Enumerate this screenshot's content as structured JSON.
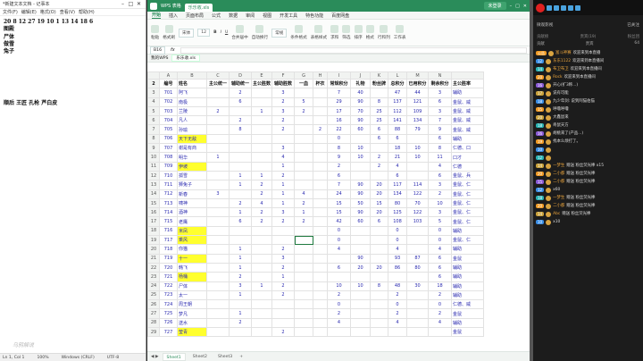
{
  "notepad": {
    "title": "*新建文本文档 - 记事本",
    "menu": [
      "文件(F)",
      "编辑(E)",
      "格式(O)",
      "查看(V)",
      "帮助(H)"
    ],
    "lines": [
      "20 8 12 27 19 10 1 13 14 18 6",
      "图殿",
      "尸体",
      "做雪",
      "兔子",
      "",
      "",
      "",
      "",
      "",
      "",
      "顺后 王匠 孔枪 芦白皮"
    ],
    "status": [
      "Ln 1, Col 1",
      "100%",
      "Windows (CRLF)",
      "UTF-8"
    ],
    "watermark": "乌鸦解说"
  },
  "wps": {
    "title_tab": "WPS 表格",
    "file_tab": "乐乐收.xls",
    "login": "未登录",
    "menu": [
      "开始",
      "插入",
      "页面布局",
      "公式",
      "数据",
      "审阅",
      "视图",
      "开发工具",
      "特色功能",
      "百度网盘"
    ],
    "ribbon": {
      "font": "宋体",
      "size": "12",
      "labels": [
        "粘贴",
        "格式刷",
        "合并居中",
        "自动换行",
        "常规",
        "条件格式",
        "表格样式",
        "求和",
        "筛选",
        "排序",
        "格式",
        "行和列",
        "工作表"
      ]
    },
    "cell_ref": "B16",
    "formula_label": "fx",
    "doc_tabs": [
      "我的WPS",
      "乐乐收.xls"
    ],
    "columns": [
      "A",
      "B",
      "C",
      "D",
      "E",
      "F",
      "G",
      "H",
      "I",
      "J",
      "K",
      "L",
      "M",
      "N"
    ],
    "sheets": [
      "Sheet1",
      "Sheet2",
      "Sheet3"
    ],
    "active_sheet": "Sheet1",
    "rows": [
      {
        "n": "2",
        "c": [
          "编号",
          "姓名",
          "主公统一",
          "辅助统一",
          "主公胜数",
          "辅助胜数",
          "一血",
          "杯衣",
          "常规积分",
          "礼物",
          "粉丝牌",
          "总积分",
          "已用积分",
          "剩余积分",
          "主公胜率"
        ],
        "hdr": true
      },
      {
        "n": "3",
        "c": [
          "701",
          "阿飞",
          "",
          "2",
          "",
          "3",
          "",
          "",
          "7",
          "40",
          "",
          "47",
          "44",
          "3",
          "辅助"
        ]
      },
      {
        "n": "4",
        "c": [
          "702",
          "南极",
          "",
          "6",
          "",
          "2",
          "5",
          "",
          "29",
          "90",
          "8",
          "137",
          "121",
          "6",
          "金鼠、威"
        ]
      },
      {
        "n": "5",
        "c": [
          "703",
          "兰陵",
          "2",
          "",
          "1",
          "3",
          "2",
          "",
          "17",
          "70",
          "25",
          "112",
          "109",
          "3",
          "金鼠、威"
        ]
      },
      {
        "n": "6",
        "c": [
          "704",
          "凡人",
          "",
          "2",
          "",
          "2",
          "",
          "",
          "16",
          "90",
          "25",
          "141",
          "134",
          "7",
          "金鼠、威"
        ]
      },
      {
        "n": "7",
        "c": [
          "705",
          "孙瑜",
          "",
          "8",
          "",
          "2",
          "",
          "2",
          "22",
          "60",
          "6",
          "88",
          "79",
          "9",
          "金鼠、威"
        ]
      },
      {
        "n": "8",
        "c": [
          "706",
          "天下无敌",
          "",
          "",
          "",
          "",
          "",
          "",
          "0",
          "",
          "6",
          "6",
          "",
          "6",
          "辅助"
        ],
        "hl": true
      },
      {
        "n": "9",
        "c": [
          "707",
          "谢是有商",
          "",
          "",
          "",
          "3",
          "",
          "",
          "8",
          "10",
          "",
          "18",
          "10",
          "8",
          "仁德、口"
        ]
      },
      {
        "n": "10",
        "c": [
          "708",
          "明华",
          "1",
          "",
          "",
          "4",
          "",
          "",
          "9",
          "10",
          "2",
          "21",
          "10",
          "11",
          "口才"
        ]
      },
      {
        "n": "11",
        "c": [
          "709",
          "伊坡",
          "",
          "",
          "",
          "1",
          "",
          "",
          "2",
          "",
          "2",
          "4",
          "",
          "4",
          "仁德"
        ],
        "hl": true
      },
      {
        "n": "12",
        "c": [
          "710",
          "孤雪",
          "",
          "1",
          "1",
          "2",
          "",
          "",
          "6",
          "",
          "",
          "6",
          "",
          "6",
          "金鼠、兵"
        ]
      },
      {
        "n": "13",
        "c": [
          "711",
          "狮兔子",
          "",
          "1",
          "2",
          "1",
          "",
          "",
          "7",
          "90",
          "20",
          "117",
          "114",
          "3",
          "金鼠、仁"
        ]
      },
      {
        "n": "14",
        "c": [
          "712",
          "新春",
          "3",
          "",
          "2",
          "1",
          "4",
          "",
          "24",
          "90",
          "20",
          "134",
          "122",
          "2",
          "金鼠、仁"
        ]
      },
      {
        "n": "15",
        "c": [
          "713",
          "啸神",
          "",
          "2",
          "4",
          "1",
          "2",
          "",
          "15",
          "50",
          "15",
          "80",
          "70",
          "10",
          "金鼠、仁"
        ]
      },
      {
        "n": "16",
        "c": [
          "714",
          "酒神",
          "",
          "1",
          "2",
          "3",
          "1",
          "",
          "15",
          "90",
          "20",
          "125",
          "122",
          "3",
          "金鼠、仁"
        ]
      },
      {
        "n": "17",
        "c": [
          "715",
          "老鹰",
          "",
          "6",
          "2",
          "2",
          "2",
          "",
          "42",
          "60",
          "6",
          "108",
          "103",
          "5",
          "金鼠、仁"
        ]
      },
      {
        "n": "18",
        "c": [
          "716",
          "米凤",
          "",
          "",
          "",
          "",
          "",
          "",
          "0",
          "",
          "",
          "0",
          "",
          "0",
          "辅助"
        ],
        "hl": true
      },
      {
        "n": "19",
        "c": [
          "717",
          "乘风",
          "",
          "",
          "",
          "",
          "",
          "",
          "0",
          "",
          "",
          "0",
          "",
          "0",
          "金鼠、仁"
        ],
        "hl": true,
        "sel": true
      },
      {
        "n": "20",
        "c": [
          "718",
          "你猫",
          "",
          "1",
          "",
          "2",
          "",
          "",
          "4",
          "",
          "",
          "4",
          "",
          "4",
          "辅助"
        ]
      },
      {
        "n": "21",
        "c": [
          "719",
          "十一",
          "",
          "1",
          "",
          "3",
          "",
          "",
          "",
          "90",
          "",
          "93",
          "87",
          "6",
          "金鼠"
        ],
        "hl": true
      },
      {
        "n": "22",
        "c": [
          "720",
          "韩飞",
          "",
          "1",
          "",
          "2",
          "",
          "",
          "6",
          "20",
          "20",
          "86",
          "80",
          "6",
          "辅助"
        ]
      },
      {
        "n": "23",
        "c": [
          "721",
          "杨桶",
          "",
          "2",
          "",
          "1",
          "",
          "",
          "",
          "",
          "",
          "",
          "",
          "6",
          "辅助"
        ],
        "hl": true
      },
      {
        "n": "24",
        "c": [
          "722",
          "尸体",
          "",
          "3",
          "1",
          "2",
          "",
          "",
          "10",
          "10",
          "8",
          "48",
          "30",
          "18",
          "辅助"
        ]
      },
      {
        "n": "25",
        "c": [
          "723",
          "太一",
          "",
          "1",
          "",
          "2",
          "",
          "",
          "2",
          "",
          "",
          "2",
          "",
          "2",
          "辅助"
        ]
      },
      {
        "n": "26",
        "c": [
          "724",
          "周王朝",
          "",
          "",
          "",
          "",
          "",
          "",
          "0",
          "",
          "",
          "0",
          "",
          "0",
          "仁德、威"
        ]
      },
      {
        "n": "27",
        "c": [
          "725",
          "梦凡",
          "",
          "1",
          "",
          "",
          "",
          "",
          "2",
          "",
          "",
          "2",
          "",
          "2",
          "金鼠"
        ]
      },
      {
        "n": "28",
        "c": [
          "726",
          "送水",
          "",
          "2",
          "",
          "",
          "",
          "",
          "4",
          "",
          "",
          "4",
          "",
          "4",
          "辅助"
        ]
      },
      {
        "n": "29",
        "c": [
          "727",
          "莹青",
          "",
          "",
          "",
          "2",
          "",
          "",
          "",
          "",
          "",
          "",
          "",
          "",
          "金鼠"
        ],
        "hl": true
      }
    ]
  },
  "chat": {
    "header_left": "微观影视",
    "header_right": "已关注",
    "stat_labels": [
      "贡献榜",
      "贵宾(19)",
      "粉丝团"
    ],
    "stat_values": [
      "贡献",
      "贵宾",
      "64"
    ],
    "messages": [
      {
        "badge": "b-orange",
        "badge_text": "公告",
        "name": "富斗神赛",
        "text": "欢迎来到本直播"
      },
      {
        "badge": "b-blue",
        "badge_text": "12",
        "name": "东东1122",
        "text": "欢迎来到本直播间"
      },
      {
        "badge": "b-teal",
        "badge_text": "14",
        "name": "布卫布卫",
        "text": "欢迎来到本直播间"
      },
      {
        "badge": "b-orange",
        "badge_text": "20",
        "name": "Rock",
        "text": "欢迎来到本直播间"
      },
      {
        "badge": "b-purple",
        "badge_text": "16",
        "name": "",
        "text": "开心(扩3称...)"
      },
      {
        "badge": "b-gold",
        "badge_text": "17",
        "name": "",
        "text": "说有可能"
      },
      {
        "badge": "b-blue",
        "badge_text": "18",
        "name": "",
        "text": "九少年剑: 说到阿猫伯猫"
      },
      {
        "badge": "b-orange",
        "badge_text": "15",
        "name": "",
        "text": "呼噜呼噜"
      },
      {
        "badge": "b-gold",
        "badge_text": "20",
        "name": "",
        "text": "大鑫鼠来"
      },
      {
        "badge": "b-teal",
        "badge_text": "18",
        "name": "",
        "text": "奇鼠天方"
      },
      {
        "badge": "b-purple",
        "badge_text": "16",
        "name": "",
        "text": "胡桃来了(产品...)"
      },
      {
        "badge": "b-orange",
        "badge_text": "19",
        "name": "",
        "text": "找本么烦打了。"
      },
      {
        "badge": "b-blue",
        "badge_text": "10",
        "name": "",
        "text": ""
      },
      {
        "badge": "b-teal",
        "badge_text": "12",
        "name": "",
        "text": ""
      },
      {
        "badge": "b-gold",
        "badge_text": "14",
        "name": "一梦生",
        "text": "赠送 粉丝荧光棒 x15"
      },
      {
        "badge": "b-orange",
        "badge_text": "20",
        "name": "二小都",
        "text": "赠送 粉丝荧光棒"
      },
      {
        "badge": "b-purple",
        "badge_text": "15",
        "name": "二小都",
        "text": "赠送 粉丝荧光棒"
      },
      {
        "badge": "b-blue",
        "badge_text": "12",
        "name": "",
        "text": "x60"
      },
      {
        "badge": "b-teal",
        "badge_text": "18",
        "name": "一梦生",
        "text": "赠送 粉丝荧光棒"
      },
      {
        "badge": "b-orange",
        "badge_text": "20",
        "name": "二小都",
        "text": "赠送 粉丝荧光棒"
      },
      {
        "badge": "b-gold",
        "badge_text": "14",
        "name": "Abc",
        "text": "赠送 粉丝荧光棒"
      },
      {
        "badge": "b-blue",
        "badge_text": "10",
        "name": "",
        "text": "x10"
      }
    ]
  }
}
